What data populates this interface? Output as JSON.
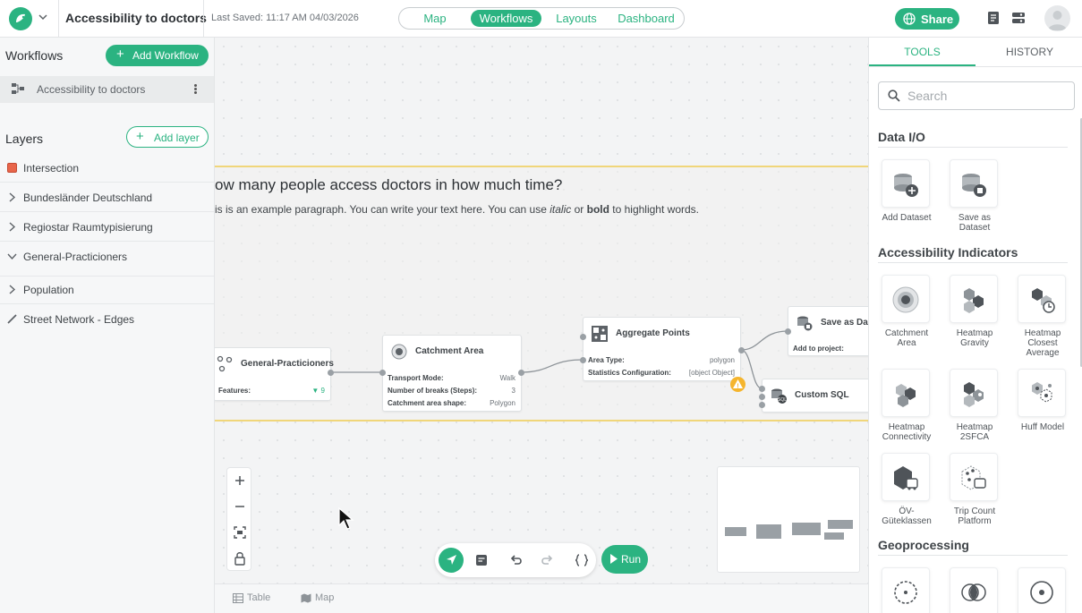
{
  "header": {
    "project_title": "Accessibility to doctors",
    "last_saved": "Last Saved: 11:17 AM 04/03/2026",
    "nav": [
      "Map",
      "Workflows",
      "Layouts",
      "Dashboard"
    ],
    "nav_active": "Workflows",
    "share_label": "Share"
  },
  "left": {
    "workflows_title": "Workflows",
    "add_workflow_label": "Add Workflow",
    "workflow_item": "Accessibility to doctors",
    "layers_title": "Layers",
    "add_layer_label": "Add layer",
    "layers": [
      {
        "label": "Intersection",
        "icon": "square-icon",
        "color": "#e8654a"
      },
      {
        "label": "Bundesländer Deutschland",
        "icon": "chevron-right-icon"
      },
      {
        "label": "Regiostar Raumtypisierung",
        "icon": "chevron-right-icon"
      },
      {
        "label": "General-Practicioners",
        "icon": "chevron-down-icon"
      },
      {
        "label": "Population",
        "icon": "chevron-right-icon"
      },
      {
        "label": "Street Network - Edges",
        "icon": "line-icon"
      }
    ]
  },
  "canvas": {
    "text_title": "ow many people access doctors in how much time?",
    "text_para_1": "is is an example paragraph. You can write your text here. You can use ",
    "text_para_italic": "italic",
    "text_para_2": " or ",
    "text_para_bold": "bold",
    "text_para_3": " to highlight words.",
    "nodes": {
      "gp": {
        "name": "General-Practicioners",
        "prop_key": "Features:",
        "prop_value": "9"
      },
      "catchment": {
        "name": "Catchment Area",
        "props": [
          {
            "k": "Transport Mode:",
            "v": "Walk"
          },
          {
            "k": "Number of breaks (Steps):",
            "v": "3"
          },
          {
            "k": "Catchment area shape:",
            "v": "Polygon"
          }
        ]
      },
      "aggregate": {
        "name": "Aggregate Points",
        "props": [
          {
            "k": "Area Type:",
            "v": "polygon"
          },
          {
            "k": "Statistics Configuration:",
            "v": "[object Object]"
          }
        ]
      },
      "save": {
        "name": "Save as Dat",
        "prop_key": "Add to project:"
      },
      "sql": {
        "name": "Custom SQL"
      }
    },
    "warning_glyph": "!",
    "run_label": "Run",
    "bottom_tabs": [
      "Table",
      "Map"
    ]
  },
  "right": {
    "tabs": [
      "TOOLS",
      "HISTORY"
    ],
    "active_tab": "TOOLS",
    "search_placeholder": "Search",
    "categories": {
      "data_io": "Data I/O",
      "accessibility": "Accessibility Indicators",
      "geoprocessing": "Geoprocessing"
    },
    "tools": {
      "add_dataset": "Add Dataset",
      "save_as_dataset": "Save as Dataset",
      "catchment_area": "Catchment Area",
      "heatmap_gravity": "Heatmap Gravity",
      "heatmap_closest": "Heatmap Closest Average",
      "heatmap_connectivity": "Heatmap Connectivity",
      "heatmap_2sfca": "Heatmap 2SFCA",
      "huff_model": "Huff Model",
      "oev_gueteklassen": "ÖV-Güteklassen",
      "trip_count": "Trip Count Platform"
    }
  },
  "colors": {
    "accent": "#2bb381",
    "warning": "#f5b52e",
    "text_node_border": "#f0d67a"
  }
}
